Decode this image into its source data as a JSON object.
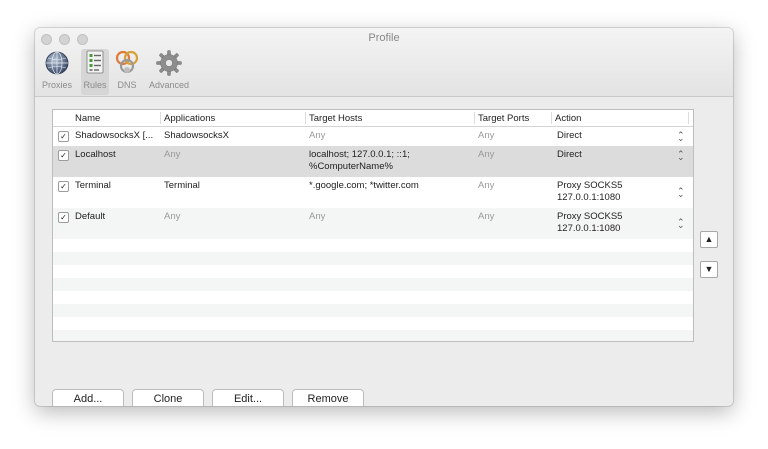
{
  "window": {
    "title": "Profile"
  },
  "toolbar": {
    "items": [
      {
        "label": "Proxies",
        "icon": "globe-icon"
      },
      {
        "label": "Rules",
        "icon": "rules-list-icon",
        "selected": true
      },
      {
        "label": "DNS",
        "icon": "dns-network-icon"
      },
      {
        "label": "Advanced",
        "icon": "gear-icon"
      }
    ]
  },
  "table": {
    "headers": [
      "Name",
      "Applications",
      "Target Hosts",
      "Target Ports",
      "Action"
    ],
    "rows": [
      {
        "checked": "✓",
        "name": "ShadowsocksX [...",
        "applications": "ShadowsocksX",
        "target_hosts": "Any",
        "target_ports": "Any",
        "action": "Direct"
      },
      {
        "checked": "✓",
        "name": "Localhost",
        "applications": "Any",
        "target_hosts": "localhost; 127.0.0.1; ::1;",
        "target_hosts_line2": "%ComputerName%",
        "target_ports": "Any",
        "action": "Direct"
      },
      {
        "checked": "✓",
        "name": "Terminal",
        "applications": "Terminal",
        "target_hosts": "*.google.com; *twitter.com",
        "target_ports": "Any",
        "action": "Proxy SOCKS5",
        "action_line2": "127.0.0.1:1080"
      },
      {
        "checked": "✓",
        "name": "Default",
        "applications": "Any",
        "target_hosts": "Any",
        "target_ports": "Any",
        "action": "Proxy SOCKS5",
        "action_line2": "127.0.0.1:1080"
      }
    ],
    "stepper_glyph": "⌃⌄"
  },
  "side_buttons": {
    "up": "▲",
    "down": "▼"
  },
  "buttons": {
    "add": "Add...",
    "clone": "Clone",
    "edit": "Edit...",
    "remove": "Remove"
  }
}
